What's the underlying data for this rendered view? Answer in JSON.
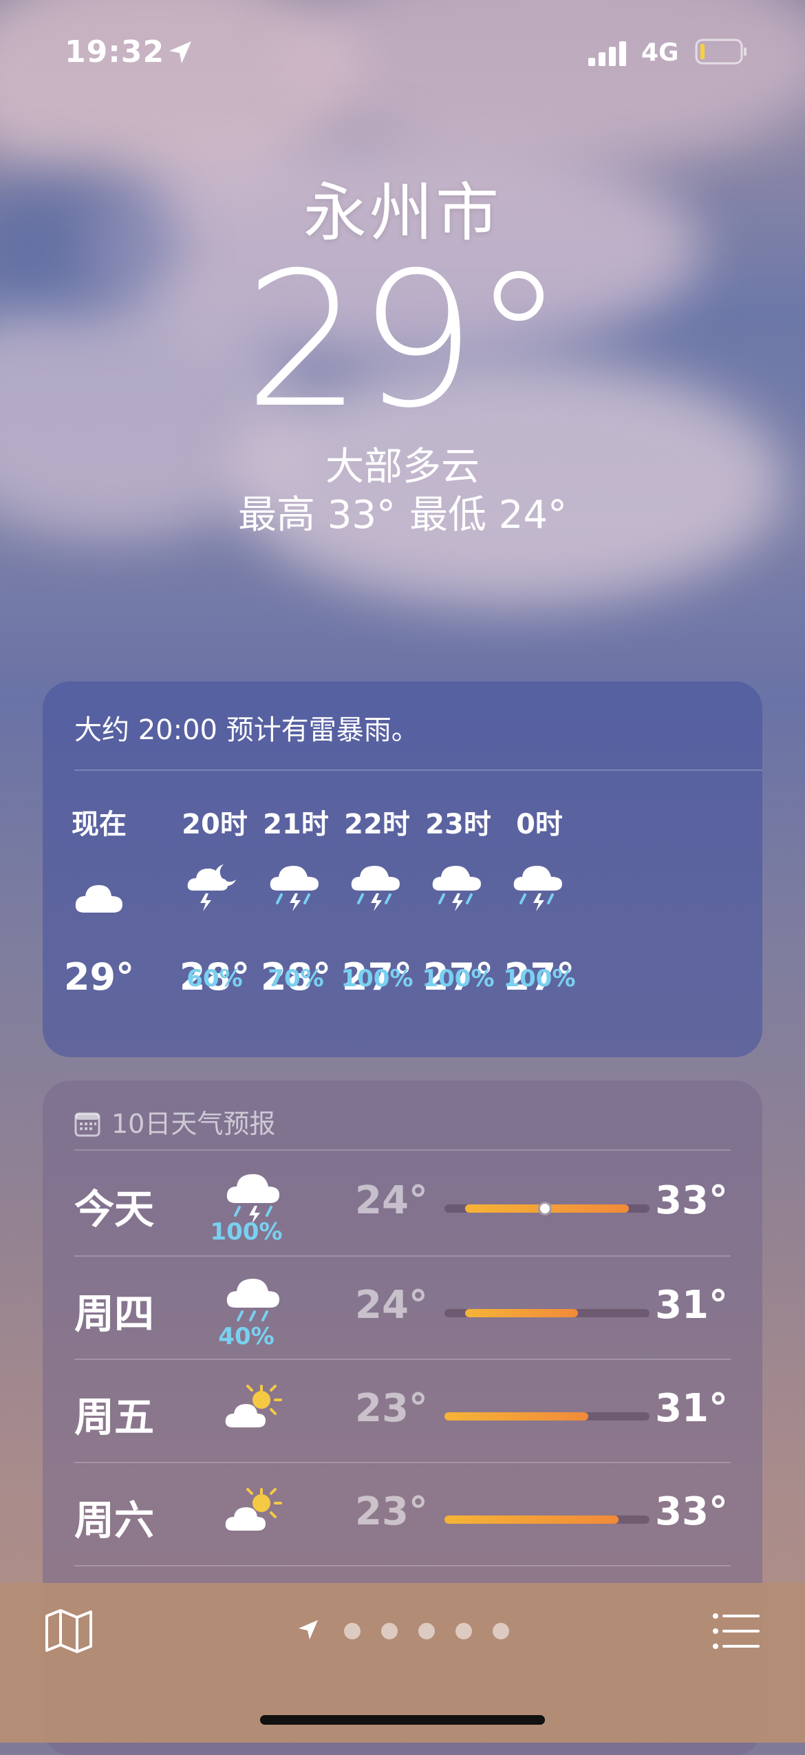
{
  "status_bar": {
    "time": "19:32",
    "network": "4G"
  },
  "location": {
    "city": "永州市",
    "temperature": "29°",
    "condition": "大部多云",
    "high": "最高 33°",
    "low": "最低 24°"
  },
  "hourly": {
    "alert": "大约 20:00 预计有雷暴雨。",
    "hours": [
      {
        "label": "现在",
        "icon": "cloud-icon",
        "precip": "",
        "temp": "29°"
      },
      {
        "label": "20时",
        "icon": "thunderstorm-night-icon",
        "precip": "60%",
        "temp": "28°"
      },
      {
        "label": "21时",
        "icon": "thunderstorm-icon",
        "precip": "70%",
        "temp": "28°"
      },
      {
        "label": "22时",
        "icon": "thunderstorm-icon",
        "precip": "100%",
        "temp": "27°"
      },
      {
        "label": "23时",
        "icon": "thunderstorm-icon",
        "precip": "100%",
        "temp": "27°"
      },
      {
        "label": "0时",
        "icon": "thunderstorm-icon",
        "precip": "100%",
        "temp": "27°"
      }
    ]
  },
  "forecast": {
    "heading": "10日天气预报",
    "days": [
      {
        "day": "今天",
        "icon": "thunderstorm-icon",
        "precip": "100%",
        "low": "24°",
        "high": "33°",
        "range_start": 0.1,
        "range_end": 0.9,
        "current": 0.49
      },
      {
        "day": "周四",
        "icon": "rain-icon",
        "precip": "40%",
        "low": "24°",
        "high": "31°",
        "range_start": 0.1,
        "range_end": 0.65
      },
      {
        "day": "周五",
        "icon": "partly-sunny-icon",
        "precip": "",
        "low": "23°",
        "high": "31°",
        "range_start": 0.0,
        "range_end": 0.7
      },
      {
        "day": "周六",
        "icon": "partly-sunny-icon",
        "precip": "",
        "low": "23°",
        "high": "33°",
        "range_start": 0.0,
        "range_end": 0.85
      }
    ]
  },
  "toolbar": {
    "map_icon": "map-icon",
    "list_icon": "list-icon",
    "page_count": 5
  },
  "colors": {
    "precip": "#7ad0f0",
    "range_gradient_start": "#f5b437",
    "range_gradient_end": "#f18a3a"
  }
}
